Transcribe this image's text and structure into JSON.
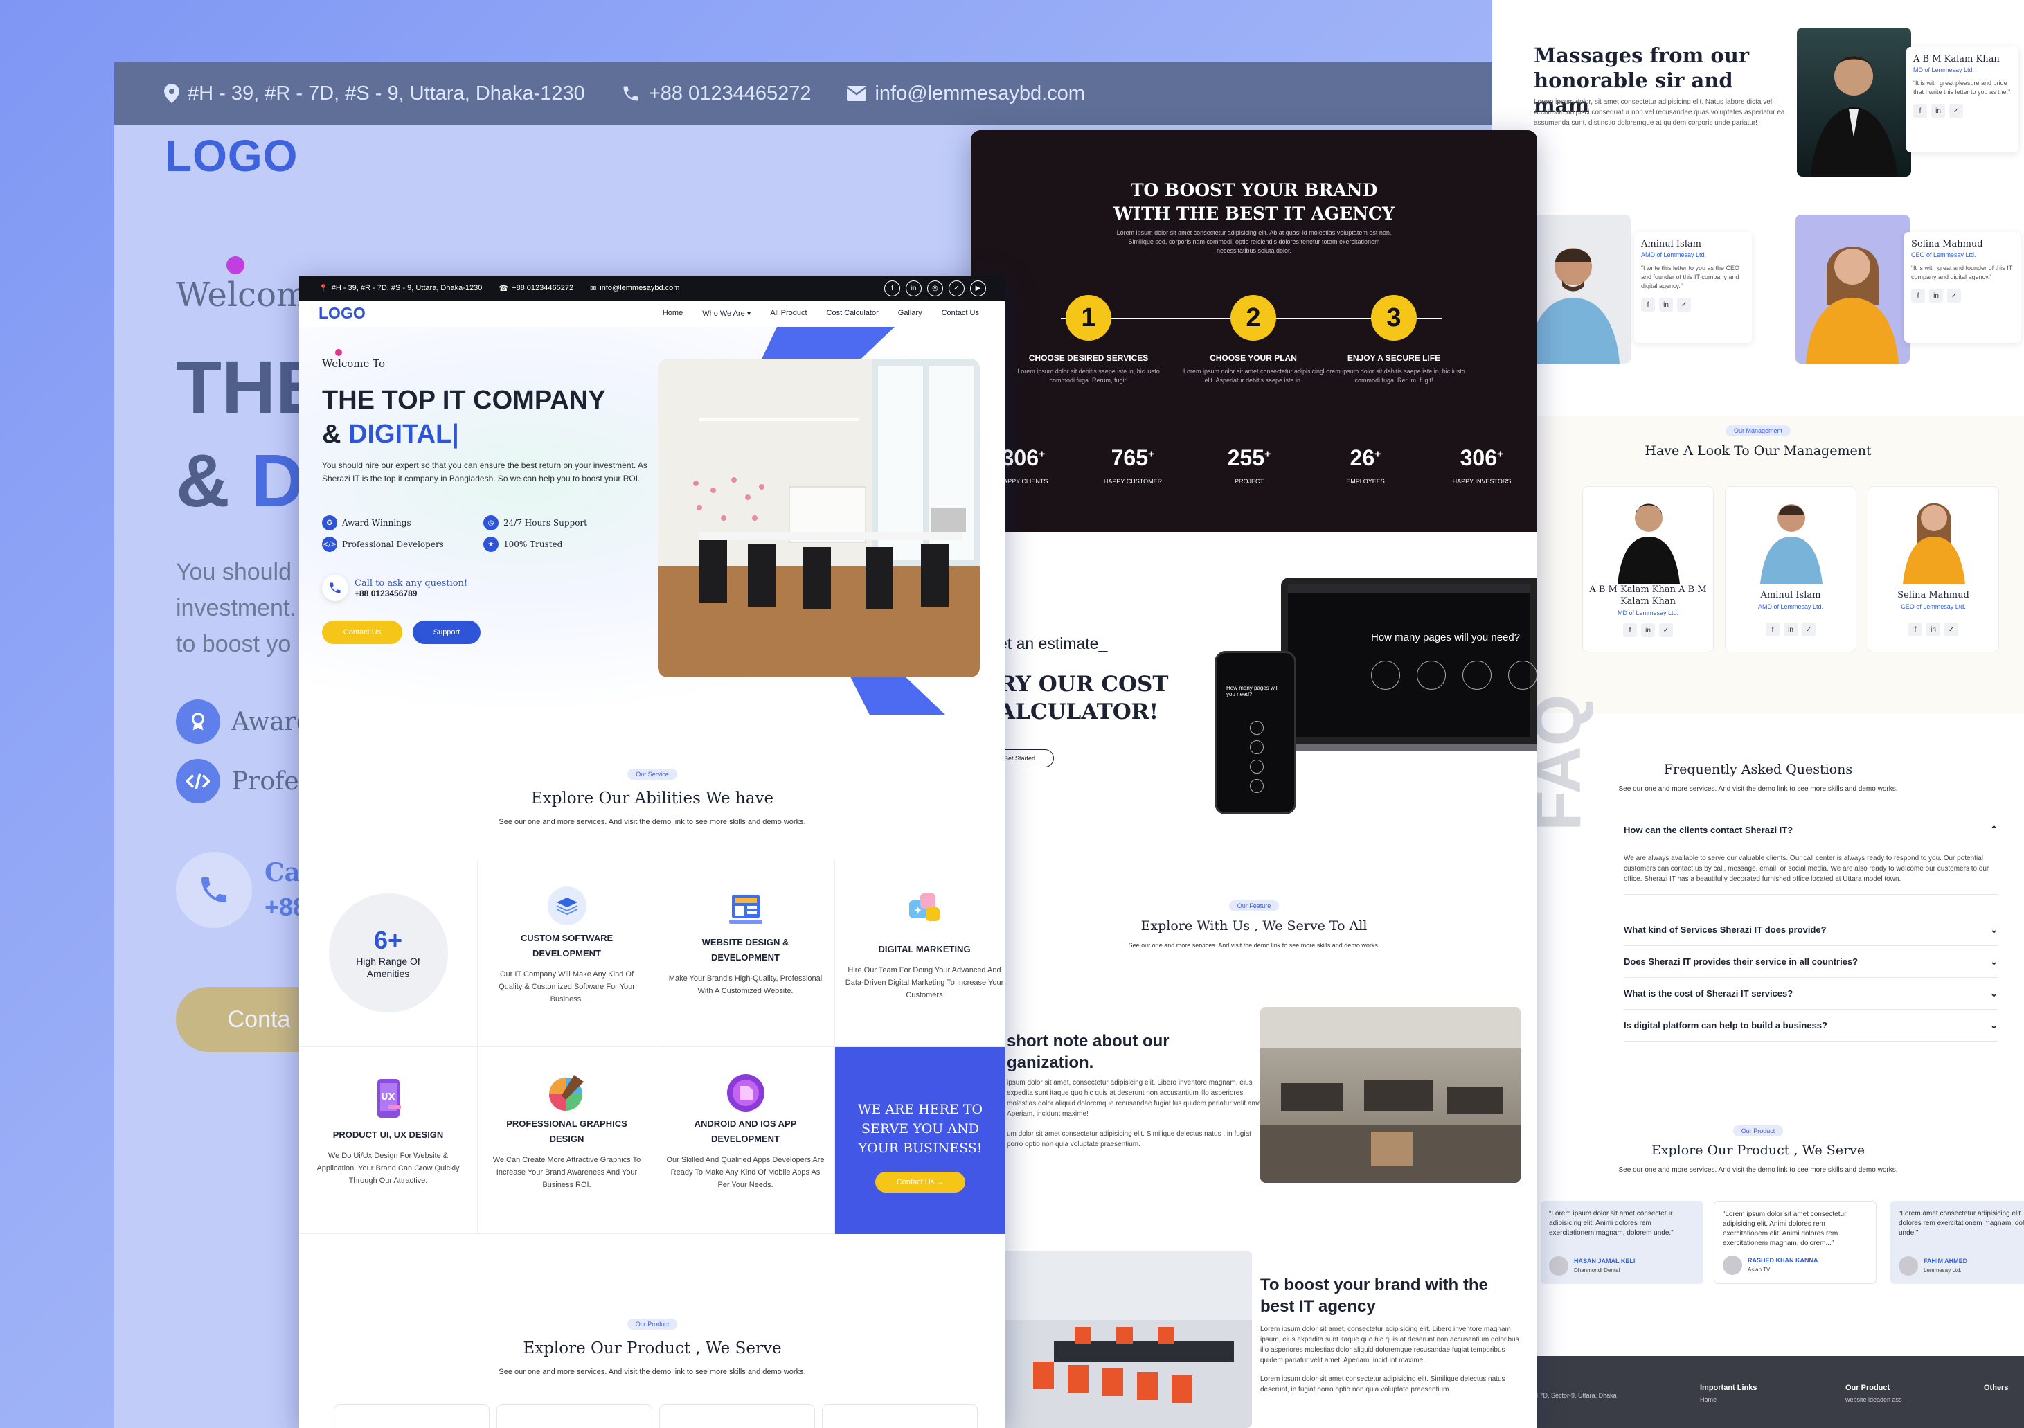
{
  "background": {
    "address": "#H - 39, #R - 7D, #S - 9, Uttara, Dhaka-1230",
    "phone": "+88 01234465272",
    "email": "info@lemmesaybd.com",
    "logo": "LOGO",
    "welcome": "Welcom",
    "h1": "THE",
    "h2a": "& ",
    "h2b": "D",
    "para": [
      "You should",
      "investment.",
      "to boost yo"
    ],
    "feat1": "Award",
    "feat2": "Profes",
    "call1": "Cal",
    "call2": "+88",
    "contact": "Conta"
  },
  "front": {
    "topbar": {
      "address": "#H - 39, #R - 7D, #S - 9, Uttara, Dhaka-1230",
      "phone": "+88 01234465272",
      "email": "info@lemmesaybd.com"
    },
    "logo": "LOGO",
    "menu": [
      "Home",
      "Who We Are ▾",
      "All Product",
      "Cost Calculator",
      "Gallary",
      "Contact Us"
    ],
    "hero": {
      "welcome": "Welcome To",
      "title1": "THE TOP IT COMPANY",
      "title2a": "& ",
      "title2b": "DIGITAL",
      "para": "You should hire our expert so that you can ensure the best return on your investment. As Sherazi IT is the top it company in Bangladesh. So we can help you to boost your ROI.",
      "features": [
        "Award Winnings",
        "24/7 Hours Support",
        "Professional Developers",
        "100% Trusted"
      ],
      "call_label": "Call to ask any question!",
      "call_number": "+88 0123456789",
      "btn_contact": "Contact Us",
      "btn_support": "Support"
    },
    "service": {
      "pill": "Our Service",
      "title": "Explore Our Abilities We have",
      "subtitle": "See our one and more services. And visit the demo link to see more skills and demo works.",
      "amenity_num": "6+",
      "amenity_label": "High Range Of Amenities",
      "items": [
        {
          "title": "CUSTOM SOFTWARE DEVELOPMENT",
          "desc": "Our IT Company Will Make Any Kind Of Quality & Customized Software For Your Business."
        },
        {
          "title": "WEBSITE DESIGN & DEVELOPMENT",
          "desc": "Make Your Brand's High-Quality, Professional With A Customized Website."
        },
        {
          "title": "DIGITAL MARKETING",
          "desc": "Hire Our Team For Doing Your Advanced And Data-Driven Digital Marketing To Increase Your Customers"
        },
        {
          "title": "PRODUCT UI, UX DESIGN",
          "desc": "We Do Ui/Ux Design For Website & Application. Your Brand Can Grow Quickly Through Our Attractive."
        },
        {
          "title": "PROFESSIONAL GRAPHICS DESIGN",
          "desc": "We Can Create More Attractive Graphics To Increase Your Brand Awareness And Your Business ROI."
        },
        {
          "title": "ANDROID AND IOS APP DEVELOPMENT",
          "desc": "Our Skilled And Qualified Apps Developers Are Ready To Make Any Kind Of Mobile Apps As Per Your Needs."
        }
      ],
      "cta_title": "WE ARE HERE TO SERVE YOU AND YOUR BUSINESS!",
      "cta_btn": "Contact Us →"
    },
    "product": {
      "pill": "Our Product",
      "title": "Explore Our Product , We Serve",
      "subtitle": "See our one and more services. And visit the demo link to see more skills and demo works."
    }
  },
  "middle": {
    "title": "TO BOOST YOUR BRAND WITH THE BEST IT AGENCY",
    "subtitle": "Lorem ipsum dolor sit amet consectetur adipisicing elit. Ab at quasi id molestias voluptatem est non. Similique sed, corporis nam commodi, optio reiciendis dolores tenetur totam exercitationem necessitatibus soluta dolor.",
    "steps": [
      {
        "num": "1",
        "label": "CHOOSE DESIRED SERVICES",
        "desc": "Lorem ipsum dolor sit debitis saepe iste in, hic iusto commodi fuga. Rerum, fugit!"
      },
      {
        "num": "2",
        "label": "CHOOSE YOUR PLAN",
        "desc": "Lorem ipsum dolor sit amet consectetur adipisicing elit. Asperiatur debitis saepe iste in."
      },
      {
        "num": "3",
        "label": "ENJOY A SECURE LIFE",
        "desc": "Lorem ipsum dolor sit debitis saepe iste in, hic iusto commodi fuga. Rerum, fugit!"
      }
    ],
    "stats": [
      {
        "value": "306",
        "label": "HAPPY CLIENTS"
      },
      {
        "value": "765",
        "label": "HAPPY CUSTOMER"
      },
      {
        "value": "255",
        "label": "PROJECT"
      },
      {
        "value": "26",
        "label": "EMPLOYEES"
      },
      {
        "value": "306",
        "label": "HAPPY INVESTORS"
      }
    ],
    "estimate": "et an estimate_",
    "cost1": "RY OUR COST",
    "cost2": "ALCULATOR!",
    "get_started": "Get Started",
    "laptop_q": "How many pages will you need?",
    "phone_q": "How many pages will you need?",
    "feature_pill": "Our Feature",
    "feature_title": "Explore With Us , We Serve To All",
    "feature_sub": "See our one and more services. And visit the demo link to see more skills and demo works.",
    "note_title1": "short note about our",
    "note_title2": "ganization.",
    "note_p1": "ipsum dolor sit amet, consectetur adipisicing elit. Libero inventore magnam, eius expedita sunt itaque quo hic quis at deserunt non accusantium illo asperiores molestias dolor aliquid doloremque recusandae fugiat lus quidem pariatur velit amet. Aperiam, incidunt maxime!",
    "note_p2": "um dolor sit amet consectetur adipisicing elit. Similique delectus natus , in fugiat porro optio non quia voluptate praesentium.",
    "boost_title": "To boost your brand with the best IT agency",
    "boost_p1": "Lorem ipsum dolor sit amet, consectetur adipisicing elit. Libero inventore magnam ipsum, eius expedita sunt itaque quo hic quis at deserunt non accusantium doloribus illo asperiores molestias dolor aliquid doloremque recusandae fugiat temporibus quidem pariatur velit amet. Aperiam, incidunt maxime!",
    "boost_p2": "Lorem ipsum dolor sit amet consectetur adipisicing elit. Similique delectus natus deserunt, in fugiat porro optio non quia voluptate praesentium."
  },
  "right": {
    "msg_title": "Massages from our honorable sir and mam",
    "msg_para": "Lorem ipsum dolor, sit amet consectetur adipisicing elit. Natus labore dicta vel! Architecto adipisci consequatur non vel recusandae quas voluptates asperiatur ea assumenda sunt, distinctio doloremque at quidem corporis unde pariatur!",
    "people": [
      {
        "name": "A B M Kalam Khan",
        "role": "MD of Lemmesay Ltd.",
        "quote": "It is with great pleasure and pride that I write this letter to you as the."
      },
      {
        "name": "Aminul Islam",
        "role": "AMD of Lemmesay Ltd.",
        "quote": "I write this letter to you as the CEO and founder of this IT company and digital agency."
      },
      {
        "name": "Selina Mahmud",
        "role": "CEO of Lemmesay Ltd.",
        "quote": "It is with great and founder of this IT company and digital agency."
      }
    ],
    "mgmt_pill": "Our Management",
    "mgmt_title": "Have A Look To Our Management",
    "mgmt": [
      {
        "name": "A B M Kalam Khan A B M Kalam Khan",
        "role": "MD of Lemmesay Ltd."
      },
      {
        "name": "Aminul Islam",
        "role": "AMD of Lemmesay Ltd."
      },
      {
        "name": "Selina Mahmud",
        "role": "CEO of Lemmesay Ltd."
      }
    ],
    "faq_word": "FAQ",
    "faq_title": "Frequently Asked Questions",
    "faq_sub": "See our one and more services. And visit the demo link to see more skills and demo works.",
    "faq_q1": "How can the clients contact Sherazi IT?",
    "faq_a1": "We are always available to serve our valuable clients. Our call center is always ready to respond to you. Our potential customers can contact us by call, message, email, or social media. We are also ready to welcome our customers to our office. Sherazi IT has a beautifully decorated furnished office located at Uttara model town.",
    "faq_qs": [
      "What kind of Services Sherazi IT does provide?",
      "Does Sherazi IT provides their service in all countries?",
      "What is the cost of Sherazi IT services?",
      "Is digital platform can help to build a business?"
    ],
    "prod_pill": "Our Product",
    "prod_title": "Explore Our Product , We Serve",
    "prod_sub": "See our one and more services. And visit the demo link to see more skills and demo works.",
    "testimonials": [
      {
        "text": "Lorem ipsum dolor sit amet consectetur adipisicing elit. Animi dolores rem exercitationem magnam, dolorem unde.",
        "name": "HASAN JAMAL KELI",
        "company": "Dhanmondi Dental"
      },
      {
        "text": "Lorem ipsum dolor sit amet consectetur adipisicing elit. Animi dolores rem exercitationem elit. Animi dolores rem exercitationem magnam, dolorem...",
        "name": "RASHED KHAN KANNA",
        "company": "Asian TV"
      },
      {
        "text": "Lorem amet consectetur adipisicing elit. Animi dolores rem exercitationem magnam, dolorem unde.",
        "name": "FAHIM AHMED",
        "company": "Lemmesay Ltd."
      }
    ],
    "footer": [
      "Important Links",
      "Our Product",
      "Others"
    ],
    "footer_addr": "...se 39, Road 7D, Sector-9, Uttara, Dhaka",
    "footer_link1": "Home",
    "footer_link2": "website ideaden ass"
  },
  "colors": {
    "blue": "#2e55d8",
    "yellow": "#f5c518",
    "dark": "#1a1216",
    "cta": "#4257e6"
  }
}
